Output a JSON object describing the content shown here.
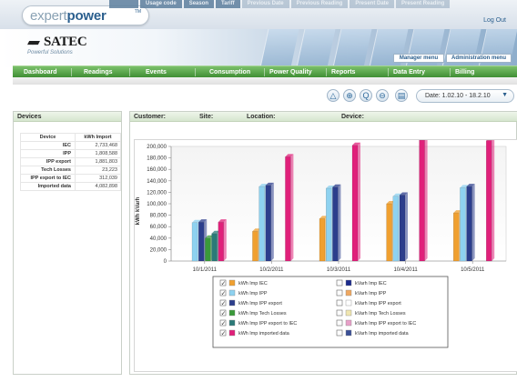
{
  "header": {
    "logo_part1": "expert",
    "logo_part2": "power",
    "logo_tm": "TM",
    "top_tabs": [
      "Usage code",
      "Season",
      "Tariff",
      "Previous Date",
      "Previous Reading",
      "Present Date",
      "Present Reading"
    ],
    "logout": "Log Out",
    "brand_name": "SATEC",
    "brand_glyph": "▰▰",
    "brand_tagline": "Powerful Solutions",
    "manager_menu": "Manager menu",
    "admin_menu": "Administration menu"
  },
  "nav": {
    "items": [
      "Dashboard",
      "Readings",
      "Events",
      "Consumption",
      "Power Quality",
      "Reports",
      "Data Entry",
      "Billing"
    ]
  },
  "toolbar": {
    "icons": [
      "warning-icon",
      "zoom-icon",
      "zoom-out-icon",
      "zoom-in-icon",
      "print-icon"
    ],
    "date_label": "Date: 1.02.10 - 18.2.10",
    "caret": "▼"
  },
  "devices": {
    "title": "Devices",
    "columns": [
      "Device",
      "kWh Import"
    ],
    "rows": [
      {
        "device": "IEC",
        "value": "2,733,468"
      },
      {
        "device": "IPP",
        "value": "1,808,588"
      },
      {
        "device": "IPP export",
        "value": "1,881,803"
      },
      {
        "device": "Tech Losses",
        "value": "23,223"
      },
      {
        "device": "IPP export to IEC",
        "value": "312,039"
      },
      {
        "device": "Imported data",
        "value": "4,082,898"
      }
    ]
  },
  "main": {
    "customer_label": "Customer:",
    "site_label": "Site:",
    "location_label": "Location:",
    "device_label": "Device:"
  },
  "colors": {
    "nav_green": "#3f8f34",
    "brand_blue": "#2b5f8e"
  },
  "chart_data": {
    "type": "bar",
    "title": "",
    "xlabel": "",
    "ylabel": "kWh kVarh",
    "ylim": [
      0,
      200000
    ],
    "yticks": [
      0,
      20000,
      40000,
      60000,
      80000,
      100000,
      120000,
      140000,
      160000,
      180000,
      200000
    ],
    "ytick_labels": [
      "0",
      "20,000",
      "40,000",
      "60,000",
      "80,000",
      "100,000",
      "120,000",
      "140,000",
      "160,000",
      "180,000",
      "200,000"
    ],
    "categories": [
      "10/1/2011",
      "10/2/2011",
      "10/3/2011",
      "10/4/2011",
      "10/5/2011"
    ],
    "series": [
      {
        "name": "kWh Imp IEC",
        "color": "#f0a030",
        "checked": true,
        "values": [
          0,
          52000,
          74000,
          100000,
          84000
        ]
      },
      {
        "name": "kWh Imp IPP",
        "color": "#8ed2f0",
        "checked": true,
        "values": [
          67000,
          130000,
          127000,
          113000,
          128000
        ]
      },
      {
        "name": "kWh Imp IPP export",
        "color": "#2c3e8c",
        "checked": true,
        "values": [
          68000,
          132000,
          129000,
          115000,
          130000
        ]
      },
      {
        "name": "kWh Imp Tech Losses",
        "color": "#3a9a3a",
        "checked": true,
        "values": [
          40000,
          0,
          0,
          0,
          0
        ]
      },
      {
        "name": "kWh Imp IPP export to IEC",
        "color": "#2b7a78",
        "checked": true,
        "values": [
          48000,
          0,
          0,
          0,
          0
        ]
      },
      {
        "name": "kWh Imp imported data",
        "color": "#e0207a",
        "checked": true,
        "values": [
          68000,
          182000,
          202000,
          211000,
          210000
        ]
      },
      {
        "name": "kVarh Imp IEC",
        "color": "#1a2a8c",
        "checked": false,
        "values": []
      },
      {
        "name": "kVarh Imp IPP",
        "color": "#f0a860",
        "checked": false,
        "values": []
      },
      {
        "name": "kVarh Imp IPP export",
        "color": "#ffffff",
        "checked": false,
        "values": []
      },
      {
        "name": "kVarh Imp Tech Losses",
        "color": "#f0e6b0",
        "checked": false,
        "values": []
      },
      {
        "name": "kVarh Imp IPP export to IEC",
        "color": "#e8a0c8",
        "checked": false,
        "values": []
      },
      {
        "name": "kVarh Imp imported data",
        "color": "#3a4f96",
        "checked": false,
        "values": []
      }
    ],
    "legend_position": "bottom",
    "grid": false
  }
}
